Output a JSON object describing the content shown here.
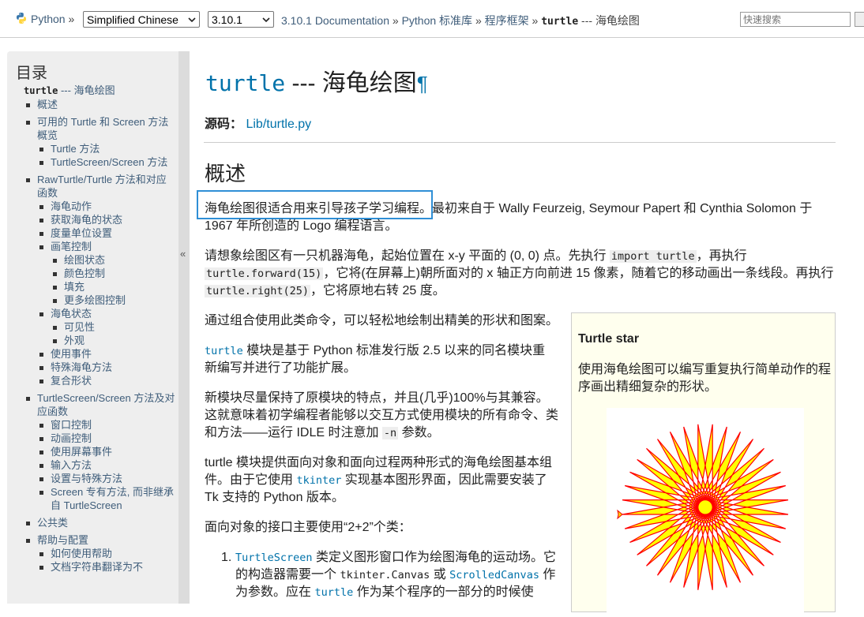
{
  "header": {
    "python_label": "Python",
    "sep": "»",
    "language_selected": "Simplified Chinese",
    "version_selected": "3.10.1",
    "breadcrumbs": [
      "3.10.1 Documentation",
      "Python 标准库",
      "程序框架"
    ],
    "current_mono": "turtle",
    "current_rest": " --- 海龟绘图",
    "search_placeholder": "快速搜索"
  },
  "toc": {
    "title": "目录",
    "root_mono": "turtle",
    "root_rest": " --- 海龟绘图",
    "items": [
      {
        "label": "概述"
      },
      {
        "label": "可用的 Turtle 和 Screen 方法概览",
        "children": [
          {
            "label": "Turtle 方法"
          },
          {
            "label": "TurtleScreen/Screen 方法"
          }
        ]
      },
      {
        "label": "RawTurtle/Turtle 方法和对应函数",
        "children": [
          {
            "label": "海龟动作"
          },
          {
            "label": "获取海龟的状态"
          },
          {
            "label": "度量单位设置"
          },
          {
            "label": "画笔控制",
            "children": [
              {
                "label": "绘图状态"
              },
              {
                "label": "颜色控制"
              },
              {
                "label": "填充"
              },
              {
                "label": "更多绘图控制"
              }
            ]
          },
          {
            "label": "海龟状态",
            "children": [
              {
                "label": "可见性"
              },
              {
                "label": "外观"
              }
            ]
          },
          {
            "label": "使用事件"
          },
          {
            "label": "特殊海龟方法"
          },
          {
            "label": "复合形状"
          }
        ]
      },
      {
        "label": "TurtleScreen/Screen 方法及对应函数",
        "children": [
          {
            "label": "窗口控制"
          },
          {
            "label": "动画控制"
          },
          {
            "label": "使用屏幕事件"
          },
          {
            "label": "输入方法"
          },
          {
            "label": "设置与特殊方法"
          },
          {
            "label": "Screen 专有方法, 而非继承自 TurtleScreen"
          }
        ]
      },
      {
        "label": "公共类"
      },
      {
        "label": "帮助与配置",
        "children": [
          {
            "label": "如何使用帮助"
          },
          {
            "label": "文档字符串翻译为不"
          }
        ]
      }
    ],
    "collapse_glyph": "«"
  },
  "main": {
    "title_mono": "turtle",
    "title_rest": " --- 海龟绘图",
    "pilcrow": "¶",
    "source_label": "源码：",
    "source_link": "Lib/turtle.py",
    "section_heading": "概述",
    "p1_highlight": "海龟绘图很适合用来引导孩子学习编程。",
    "p1_line1_rest": "最初来自于 Wally Feurzeig, Seymour Papert 和 Cynthia Solomon 于",
    "p1_line2": "1967 年所创造的 Logo 编程语言。",
    "p2_a": "请想象绘图区有一只机器海龟，起始位置在 x-y 平面的 (0, 0) 点。先执行 ",
    "p2_code1": "import turtle",
    "p2_b": "，再执行",
    "p2_code2": "turtle.forward(15)",
    "p2_c": "，它将(在屏幕上)朝所面对的 x 轴正方向前进 15 像素，随着它的移动画出一条线段。再执行",
    "p2_code3": "turtle.right(25)",
    "p2_d": "，它将原地右转 25 度。",
    "p3": "通过组合使用此类命令，可以轻松地绘制出精美的形状和图案。",
    "p4_code": "turtle",
    "p4_a": " 模块是基于 Python 标准发行版 2.5 以来的同名模块重",
    "p4_b": "新编写并进行了功能扩展。",
    "p5_a": "新模块尽量保持了原模块的特点，并且(几乎)100%与其兼容。",
    "p5_b": "这就意味着初学编程者能够以交互方式使用模块的所有命令、类",
    "p5_c": "和方法——运行 IDLE 时注意加 ",
    "p5_code": "-n",
    "p5_d": " 参数。",
    "p6_a": "turtle 模块提供面向对象和面向过程两种形式的海龟绘图基本组",
    "p6_b": "件。由于它使用 ",
    "p6_code": "tkinter",
    "p6_c": " 实现基本图形界面，因此需要安装了",
    "p6_d": "Tk 支持的 Python 版本。",
    "p7": "面向对象的接口主要使用“2+2”个类：",
    "li1_num": "1.",
    "li1_code": "TurtleScreen",
    "li1_a": " 类定义图形窗口作为绘图海龟的运动场。它",
    "li1_b": "的构造器需要一个 ",
    "li1_code2": "tkinter.Canvas",
    "li1_c": " 或 ",
    "li1_code3": "ScrolledCanvas",
    "li1_d": " 作",
    "li1_e": "为参数。应在 ",
    "li1_code4": "turtle",
    "li1_f": " 作为某个程序的一部分的时候使"
  },
  "sidebox": {
    "title": "Turtle star",
    "body": "使用海龟绘图可以编写重复执行简单动作的程序画出精细复杂的形状。",
    "star_stroke": "#ff0000",
    "star_fill": "#ffff00"
  }
}
